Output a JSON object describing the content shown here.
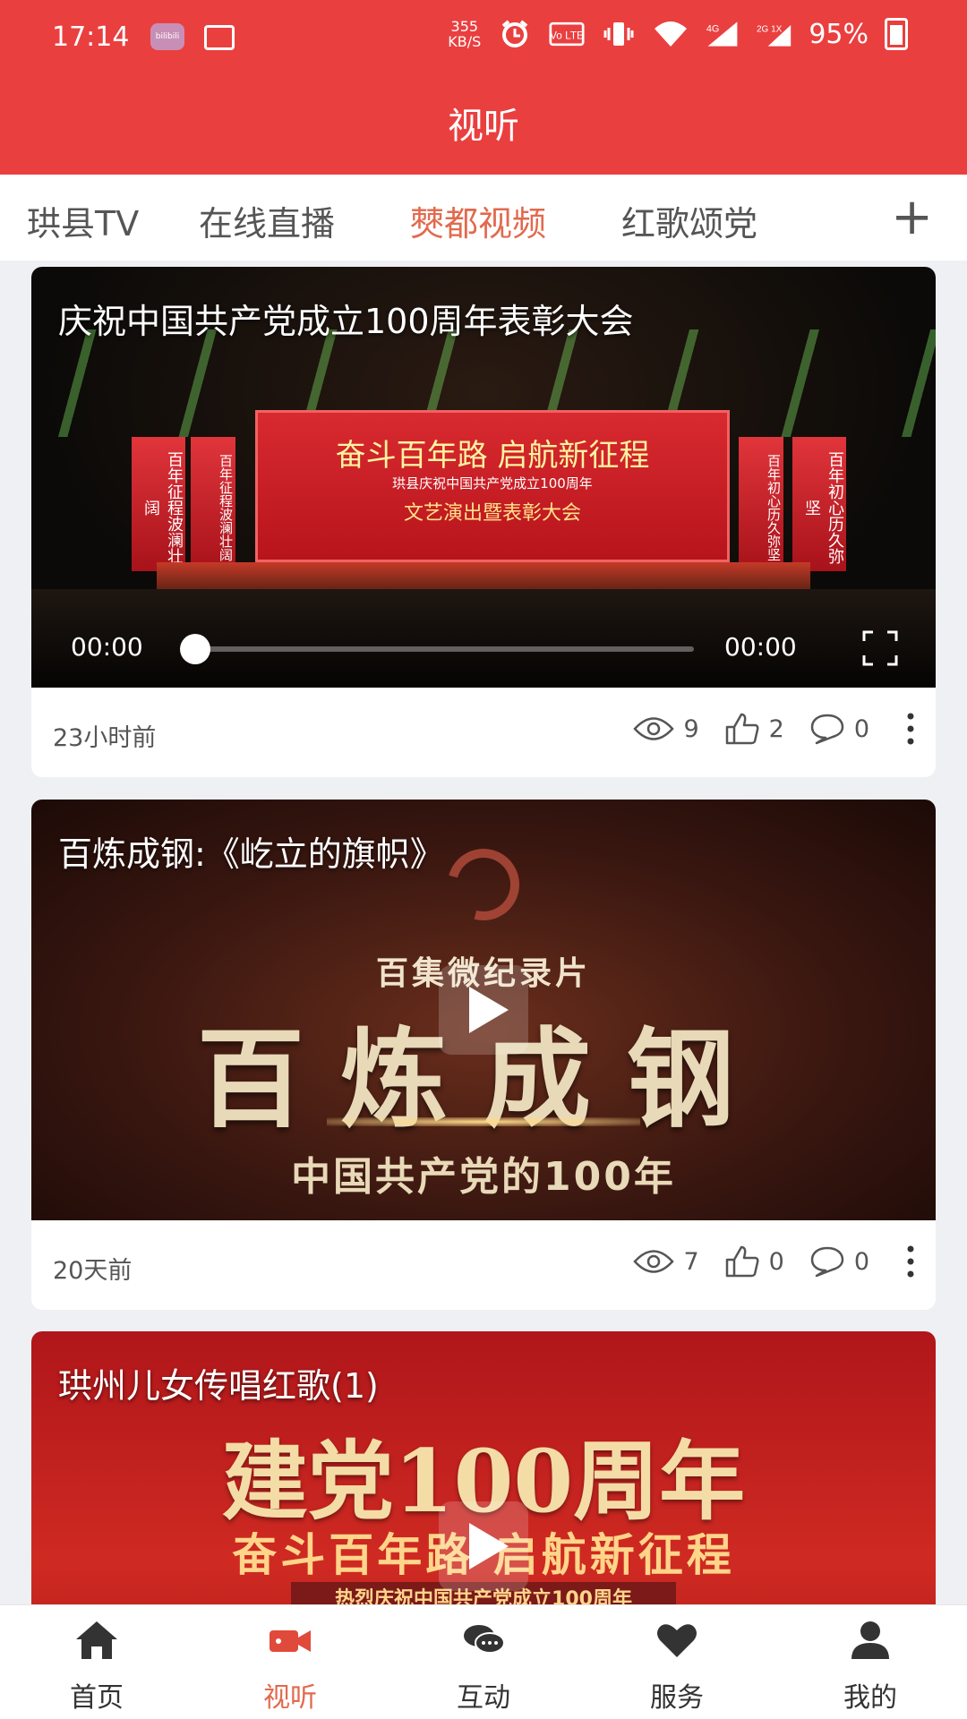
{
  "status_bar": {
    "time": "17:14",
    "app_badge": "bilibili",
    "net_speed_value": "355",
    "net_speed_unit": "KB/S",
    "volte_label": "Vo LTE",
    "network_4g": "4G",
    "network_2g": "2G 1X",
    "battery": "95%"
  },
  "header": {
    "title": "视听"
  },
  "channel_tabs": {
    "items": [
      {
        "label": "珙县TV",
        "active": false
      },
      {
        "label": "在线直播",
        "active": false
      },
      {
        "label": "僰都视频",
        "active": true
      },
      {
        "label": "红歌颂党",
        "active": false
      }
    ],
    "add_icon": "plus-icon"
  },
  "feed": [
    {
      "title": "庆祝中国共产党成立100周年表彰大会",
      "time_ago": "23小时前",
      "views": "9",
      "likes": "2",
      "comments": "0",
      "player": {
        "current": "00:00",
        "duration": "00:00"
      },
      "frame_text": {
        "screen_main": "奋斗百年路 启航新征程",
        "screen_sub": "珙县庆祝中国共产党成立100周年",
        "screen_line3": "文艺演出暨表彰大会",
        "left_banner": "百年征程波澜壮阔",
        "right_banner": "百年初心历久弥坚"
      }
    },
    {
      "title": "百炼成钢:《屹立的旗帜》",
      "time_ago": "20天前",
      "views": "7",
      "likes": "0",
      "comments": "0",
      "frame_text": {
        "sub": "百集微纪录片",
        "big": "百炼成钢",
        "bottom": "中国共产党的100年"
      }
    },
    {
      "title": "珙州儿女传唱红歌(1)",
      "frame_text": {
        "head": "建党100周年",
        "line2": "奋斗百年路  启航新征程",
        "band": "热烈庆祝中国共产党成立100周年"
      }
    }
  ],
  "bottom_nav": [
    {
      "label": "首页",
      "icon": "home-icon",
      "active": false
    },
    {
      "label": "视听",
      "icon": "video-camera-icon",
      "active": true
    },
    {
      "label": "互动",
      "icon": "chat-icon",
      "active": false
    },
    {
      "label": "服务",
      "icon": "heart-icon",
      "active": false
    },
    {
      "label": "我的",
      "icon": "user-icon",
      "active": false
    }
  ],
  "colors": {
    "brand_red": "#ea3f3f",
    "active_tab": "#e26a4e"
  }
}
